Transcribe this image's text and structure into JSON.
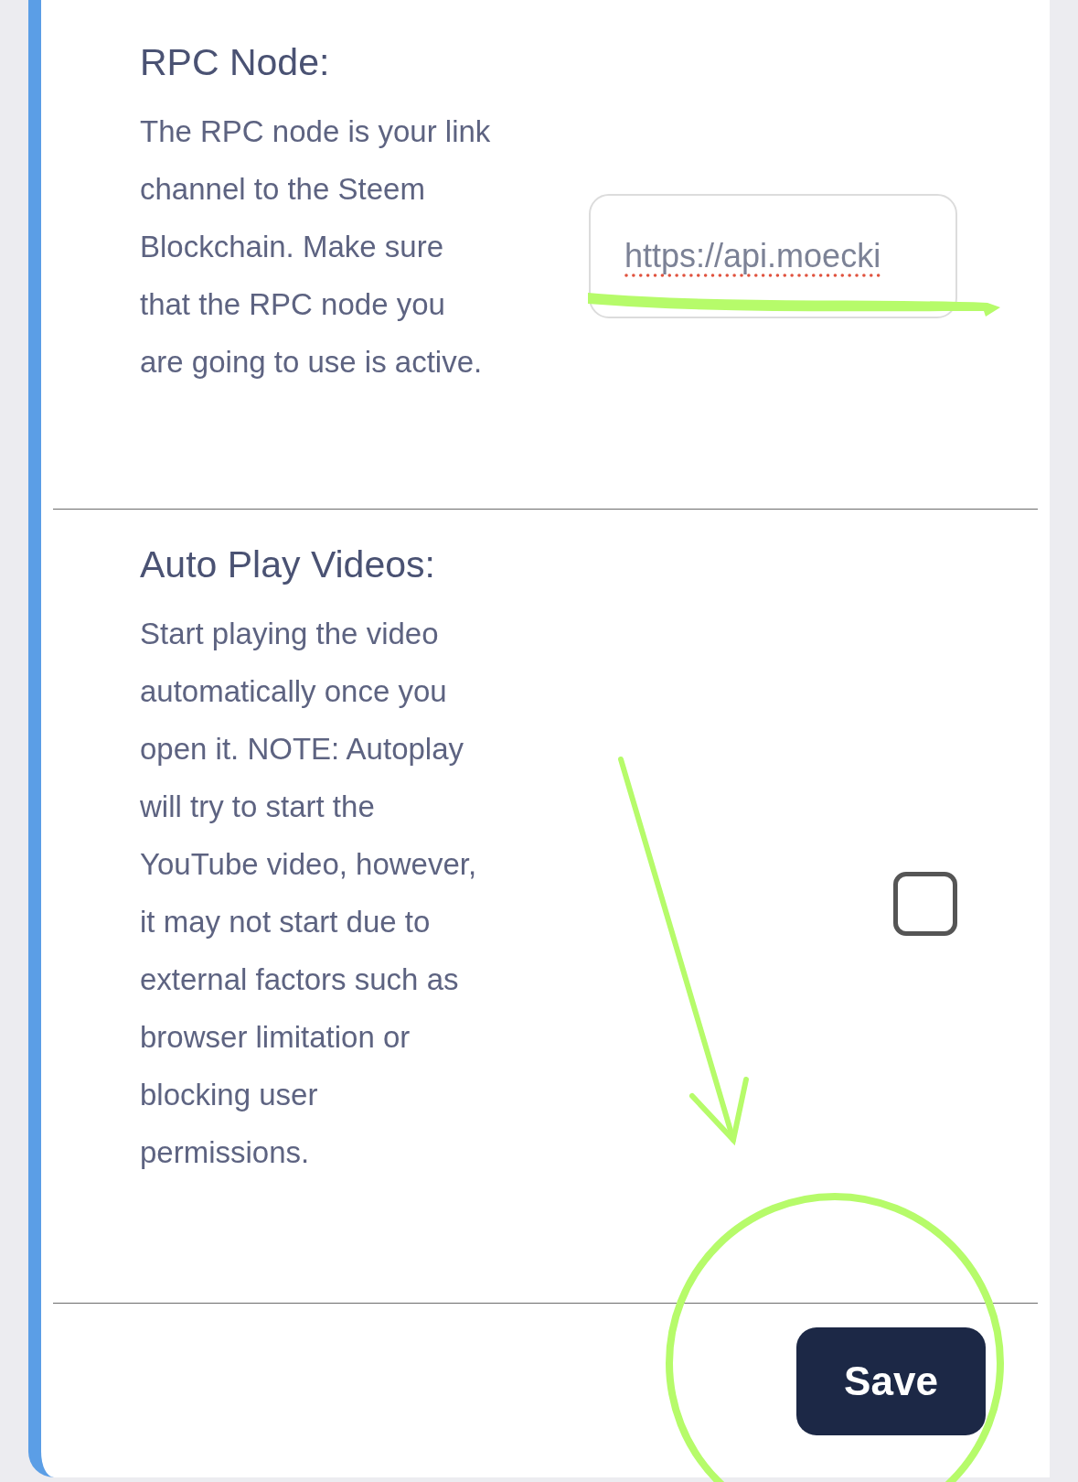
{
  "sections": [
    {
      "kind": "text-input",
      "title": "RPC Node:",
      "description": "The RPC node is your link channel to the Steem Blockchain. Make sure that the RPC node you are going to use is active.",
      "value": "https://api.moecki"
    },
    {
      "kind": "checkbox",
      "title": "Auto Play Videos:",
      "description": "Start playing the video automatically once you open it. NOTE: Autoplay will try to start the YouTube video, however, it may not start due to external factors such as browser limitation or blocking user permissions.",
      "checked": false
    }
  ],
  "save_button": "Save"
}
